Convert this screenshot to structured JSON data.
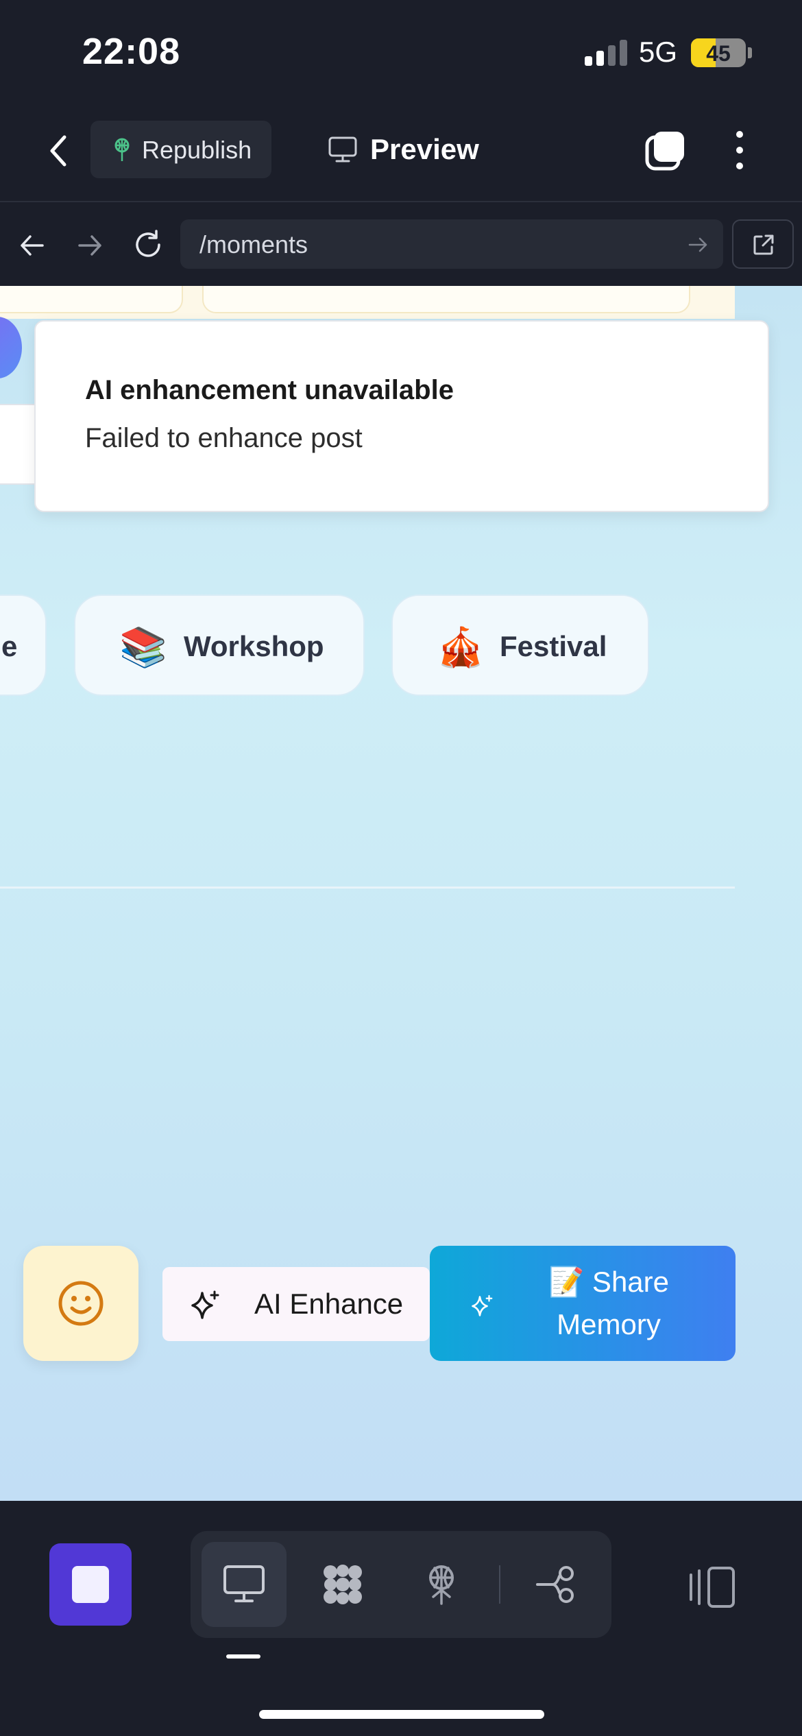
{
  "status_bar": {
    "time": "22:08",
    "network": "5G",
    "battery": "45",
    "battery_level": 0.45
  },
  "toolbar": {
    "republish_label": "Republish",
    "preview_label": "Preview"
  },
  "browser": {
    "url": "/moments"
  },
  "toast": {
    "title": "AI enhancement unavailable",
    "description": "Failed to enhance post"
  },
  "chips": [
    {
      "label": "e",
      "emoji": ""
    },
    {
      "label": "Workshop",
      "emoji": "📚"
    },
    {
      "label": "Festival",
      "emoji": "🎪"
    }
  ],
  "actions": {
    "ai_enhance_label": "AI Enhance",
    "share_label": "📝 Share Memory"
  },
  "colors": {
    "accent_purple": "#5138d6",
    "share_gradient_start": "#0ea8d8",
    "share_gradient_end": "#3f7ff0",
    "republish_icon": "#4cc38a"
  }
}
